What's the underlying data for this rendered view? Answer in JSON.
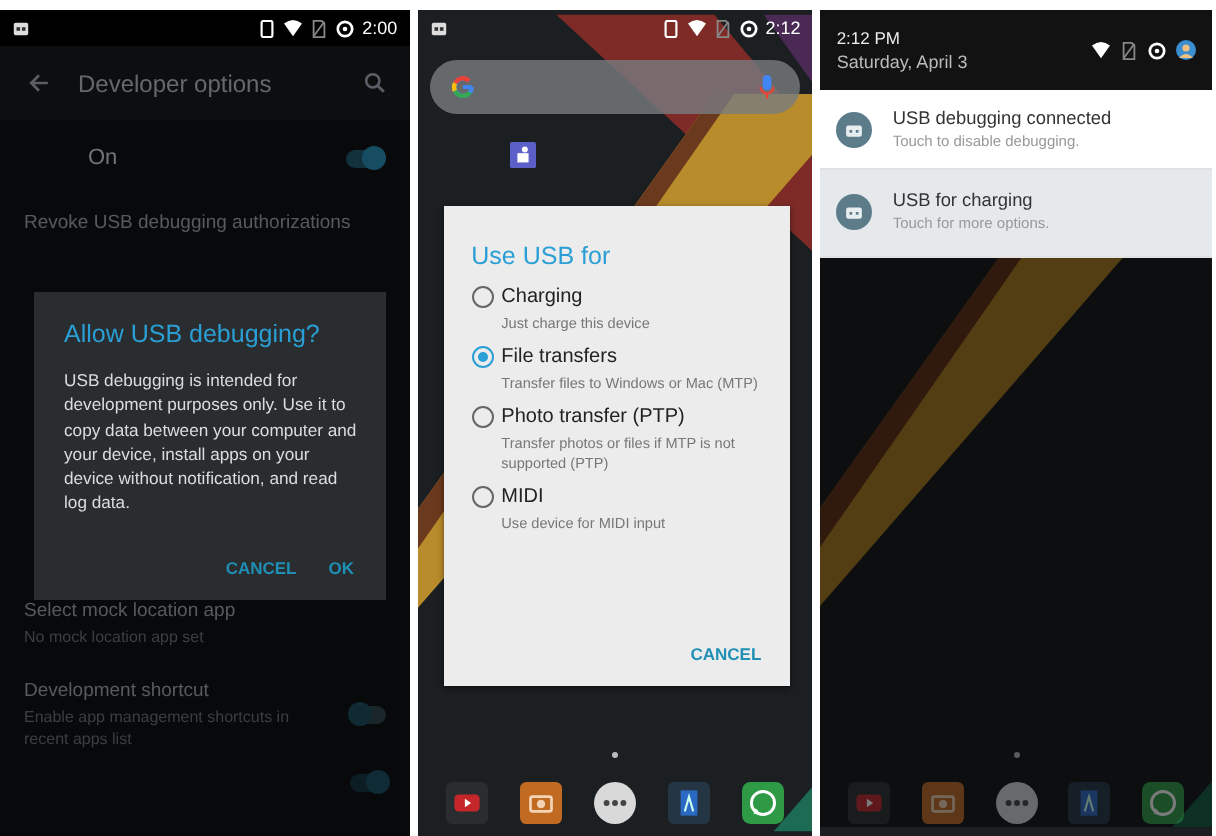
{
  "panels": [
    {
      "kind": "settings",
      "status_bar": {
        "time": "2:00"
      },
      "app_bar": {
        "title": "Developer options"
      },
      "master_switch": {
        "label": "On",
        "on": true
      },
      "items": [
        {
          "kind": "plain",
          "title": "Revoke USB debugging authorizations"
        },
        {
          "kind": "gap"
        },
        {
          "kind": "plain",
          "title": "Select mock location app",
          "subtitle": "No mock location app set"
        },
        {
          "kind": "toggle",
          "title": "Development shortcut",
          "subtitle": "Enable app management shortcuts in recent apps list",
          "on": false
        },
        {
          "kind": "toggle_only",
          "on": true
        }
      ],
      "dialog": {
        "title": "Allow USB debugging?",
        "message": "USB debugging is intended for development purposes only. Use it to copy data between your computer and your device, install apps on your device without notification, and read log data.",
        "buttons": [
          "CANCEL",
          "OK"
        ]
      }
    },
    {
      "kind": "home",
      "status_bar": {
        "time": "2:12"
      },
      "dialog": {
        "title": "Use USB for",
        "options": [
          {
            "label": "Charging",
            "description": "Just charge this device",
            "selected": false
          },
          {
            "label": "File transfers",
            "description": "Transfer files to Windows or Mac (MTP)",
            "selected": true
          },
          {
            "label": "Photo transfer (PTP)",
            "description": "Transfer photos or files if MTP is not supported (PTP)",
            "selected": false
          },
          {
            "label": "MIDI",
            "description": "Use device for MIDI input",
            "selected": false
          }
        ],
        "buttons": [
          "CANCEL"
        ]
      }
    },
    {
      "kind": "shade",
      "header": {
        "time": "2:12 PM",
        "date": "Saturday, April 3"
      },
      "notifications": [
        {
          "title": "USB debugging connected",
          "text": "Touch to disable debugging.",
          "selected": false
        },
        {
          "title": "USB for charging",
          "text": "Touch for more options.",
          "selected": true
        }
      ]
    }
  ]
}
